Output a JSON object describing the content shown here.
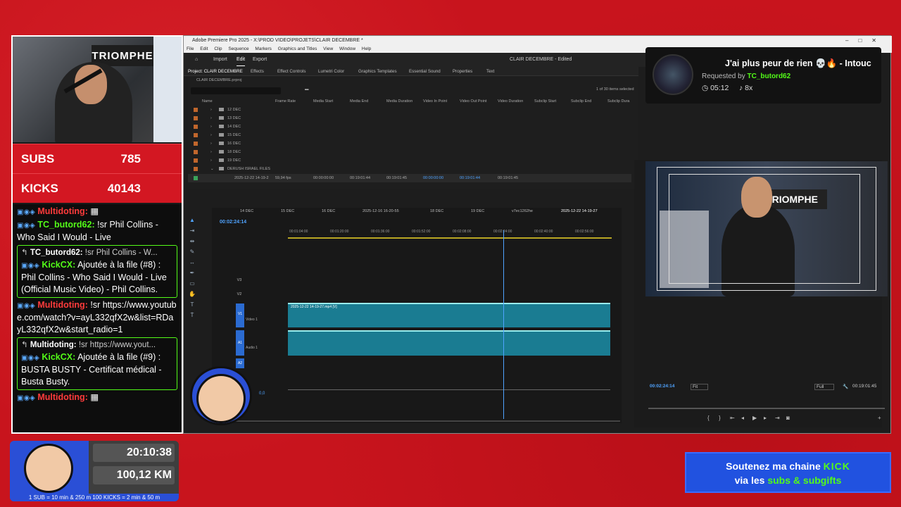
{
  "webcam": {
    "banner_text": "TRIOMPHE"
  },
  "stats": {
    "subs_label": "SUBS",
    "subs_value": "785",
    "kicks_label": "KICKS",
    "kicks_value": "40143"
  },
  "chat": [
    {
      "user": "Multidoting:",
      "text": "",
      "type": "plain",
      "ucolor": "red"
    },
    {
      "user": "TC_butord62:",
      "text": "!sr Phil Collins - Who Said I Would - Live",
      "type": "plain",
      "ucolor": "green"
    },
    {
      "reply_user": "TC_butord62:",
      "reply_text": "!sr Phil Collins - W...",
      "user": "KickCX:",
      "text": "Ajoutée à la file (#8) : Phil Collins - Who Said I Would - Live (Official Music Video) - Phil Collins.",
      "type": "boxed",
      "ucolor": "green"
    },
    {
      "user": "Multidoting:",
      "text": "!sr https://www.youtube.com/watch?v=ayL332qfX2w&list=RDayL332qfX2w&start_radio=1",
      "type": "plain",
      "ucolor": "red"
    },
    {
      "reply_user": "Multidoting:",
      "reply_text": "!sr https://www.yout...",
      "user": "KickCX:",
      "text": "Ajoutée à la file (#9) : BUSTA BUSTY - Certificat médical - Busta Busty.",
      "type": "boxed",
      "ucolor": "green"
    },
    {
      "user": "Multidoting:",
      "text": "",
      "type": "plain",
      "ucolor": "red"
    }
  ],
  "premiere": {
    "title": "Adobe Premiere Pro 2025 - X:\\PROD VIDEO\\PROJETS\\CLAIR DECEMBRE *",
    "menu": [
      "File",
      "Edit",
      "Clip",
      "Sequence",
      "Markers",
      "Graphics and Titles",
      "View",
      "Window",
      "Help"
    ],
    "header": {
      "import": "Import",
      "edit": "Edit",
      "export": "Export",
      "doc_title": "CLAIR DECEMBRE - Edited"
    },
    "panels": [
      "Project: CLAIR DECEMBRE",
      "Effects",
      "Effect Controls",
      "Lumetri Color",
      "Graphics Templates",
      "Essential Sound",
      "Properties",
      "Text"
    ],
    "project_file": "CLAIR DECEMBRE.prproj",
    "items_selected": "1 of 30 items selected",
    "columns": [
      "Name",
      "Frame Rate",
      "Media Start",
      "Media End",
      "Media Duration",
      "Video In Point",
      "Video Out Point",
      "Video Duration",
      "Subclip Start",
      "Subclip End",
      "Subclip Dura"
    ],
    "bins": [
      "12 DEC",
      "13 DEC",
      "14 DEC",
      "15 DEC",
      "16 DEC",
      "18 DEC",
      "19 DEC",
      "DERUSH ISRAEL FILES"
    ],
    "clip_row": {
      "name": "2025-12-22 14-19-2",
      "fps": "59,94 fps",
      "start": "00:00:00:00",
      "end": "00:19:01:44",
      "duration": "00:19:01:45",
      "in": "00:00:00:00",
      "out": "00:19:01:44",
      "vdur": "00:19:01:45"
    },
    "sequence_tabs": [
      "14 DEC",
      "15 DEC",
      "16 DEC",
      "2025-12-16 16-20-55",
      "18 DEC",
      "19 DEC",
      "v7ec1262he",
      "2025-12-22 14-19-27"
    ],
    "timecode": "00:02:24:14",
    "ruler": [
      "00:01:04:00",
      "00:01:20:00",
      "00:01:36:00",
      "00:01:52:00",
      "00:02:08:00",
      "00:02:24:00",
      "00:02:40:00",
      "00:02:56:00"
    ],
    "tracks": {
      "v3": "V3",
      "v2": "V2",
      "v1": "V1",
      "video1": "Video 1",
      "a1": "A1",
      "audio1": "Audio 1",
      "a2": "A2",
      "vol": "0,0"
    },
    "clip_label": "2025-12-22 14-19-27.mp4 [V]",
    "preview": {
      "banner": "TRIOMPHE",
      "timecode": "00:02:24:14",
      "fit": "Fit",
      "full": "Full",
      "duration": "00:19:01:45"
    }
  },
  "now_playing": {
    "title": "J'ai plus peur de rien 💀🔥 - Intouc",
    "requested_label": "Requested by",
    "requested_by": "TC_butord62",
    "time": "05:12",
    "plays": "8x"
  },
  "counter": {
    "time": "20:10:38",
    "distance": "100,12 KM",
    "rules": "1 SUB = 10 min & 250 m    100 KICKS = 2 min & 50 m"
  },
  "support": {
    "line1_prefix": "Soutenez ma chaine",
    "line1_brand": "KICK",
    "line2_prefix": "via les",
    "line2_highlight": "subs & subgifts"
  }
}
